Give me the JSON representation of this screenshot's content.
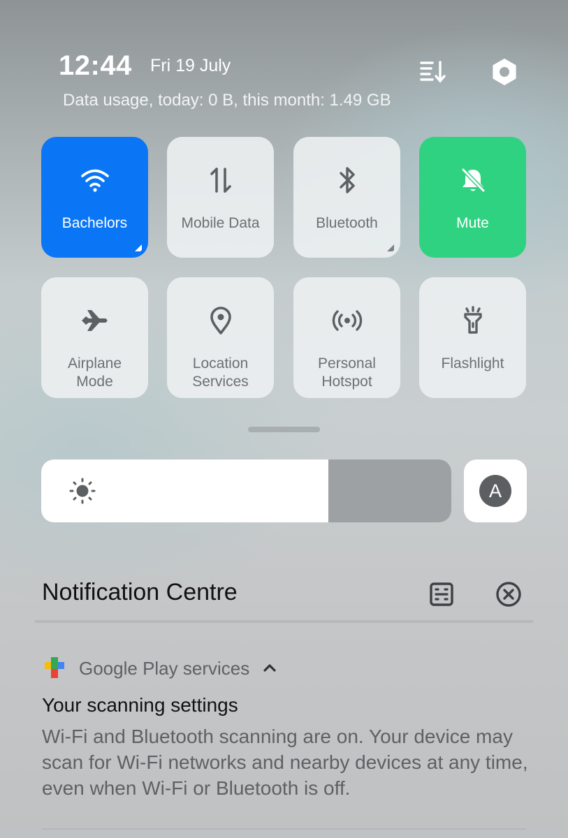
{
  "header": {
    "time": "12:44",
    "date": "Fri 19 July",
    "data_usage": "Data usage, today: 0 B, this month: 1.49 GB",
    "icons": {
      "edit": "edit-tiles-icon",
      "settings": "settings-hexagon-icon"
    }
  },
  "tiles": {
    "row1": [
      {
        "label": "Bachelors",
        "icon": "wifi-icon",
        "state": "on",
        "accent": "#0a76f5"
      },
      {
        "label": "Mobile Data",
        "icon": "mobile-data-icon",
        "state": "off"
      },
      {
        "label": "Bluetooth",
        "icon": "bluetooth-icon",
        "state": "off"
      },
      {
        "label": "Mute",
        "icon": "bell-off-icon",
        "state": "on",
        "accent": "#2fd280"
      }
    ],
    "row2": [
      {
        "label_line1": "Airplane",
        "label_line2": "Mode",
        "icon": "airplane-icon",
        "state": "off"
      },
      {
        "label_line1": "Location",
        "label_line2": "Services",
        "icon": "location-pin-icon",
        "state": "off"
      },
      {
        "label_line1": "Personal",
        "label_line2": "Hotspot",
        "icon": "hotspot-icon",
        "state": "off"
      },
      {
        "label": "Flashlight",
        "icon": "flashlight-icon",
        "state": "off"
      }
    ]
  },
  "brightness": {
    "level_percent": 70,
    "icon": "sun-icon",
    "auto_label": "A"
  },
  "notification_centre": {
    "title": "Notification Centre",
    "icons": {
      "manage": "manage-notifications-icon",
      "clear": "clear-all-icon"
    }
  },
  "notifications": [
    {
      "app": "Google Play services",
      "app_icon": "google-play-services-icon",
      "title": "Your scanning settings",
      "body": "Wi-Fi and Bluetooth scanning are on. Your device may scan for Wi-Fi networks and nearby devices at any time, even when Wi-Fi or Bluetooth is off."
    }
  ]
}
